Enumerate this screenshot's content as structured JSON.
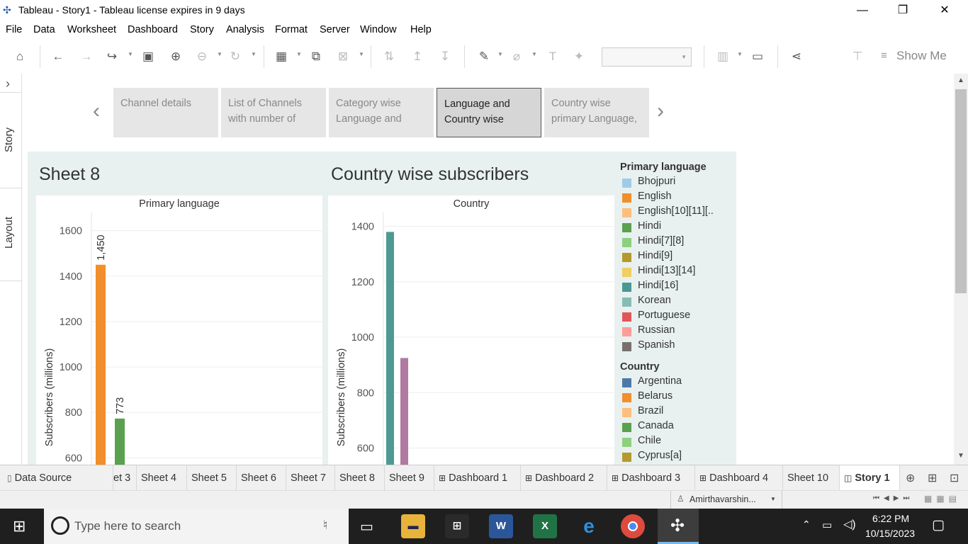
{
  "window": {
    "title": "Tableau - Story1 - Tableau license expires in 9 days",
    "minimize": "—",
    "restore": "❐",
    "close": "✕"
  },
  "menu": [
    "File",
    "Data",
    "Worksheet",
    "Dashboard",
    "Story",
    "Analysis",
    "Format",
    "Server",
    "Window",
    "Help"
  ],
  "toolbar": {
    "show_me": "Show Me"
  },
  "left_rail": {
    "story_label": "Story",
    "layout_label": "Layout",
    "expand": "›"
  },
  "story_points": [
    {
      "label": "Channel details"
    },
    {
      "label": "List of Channels with number of"
    },
    {
      "label": "Category wise Language and"
    },
    {
      "label": "Language and Country wise"
    },
    {
      "label": "Country wise primary Language,"
    }
  ],
  "story_nav": {
    "prev": "‹",
    "next": "›"
  },
  "dashboard": {
    "left_title": "Sheet 8",
    "right_title": "Country wise subscribers",
    "left_chart": {
      "header": "Primary language",
      "y_label": "Subscribers (millions)",
      "ticks": [
        "1600",
        "1400",
        "1200",
        "1000",
        "800",
        "600"
      ]
    },
    "right_chart": {
      "header": "Country",
      "y_label": "Subscribers (millions)",
      "ticks": [
        "1400",
        "1200",
        "1000",
        "800",
        "600"
      ]
    }
  },
  "chart_data": [
    {
      "type": "bar",
      "title": "Sheet 8",
      "xlabel": "Primary language",
      "ylabel": "Subscribers (millions)",
      "ylim": [
        570,
        1680
      ],
      "categories": [
        "English",
        "Hindi"
      ],
      "values": [
        1450,
        773
      ],
      "value_labels": [
        "1,450",
        "773"
      ],
      "colors": [
        "#f28e2b",
        "#59a14f"
      ]
    },
    {
      "type": "bar",
      "title": "Country wise subscribers",
      "xlabel": "Country",
      "ylabel": "Subscribers (millions)",
      "ylim": [
        540,
        1450
      ],
      "categories": [
        "bar1",
        "bar2"
      ],
      "values": [
        1380,
        925
      ],
      "colors": [
        "#4e9a93",
        "#b07aa1"
      ]
    }
  ],
  "legend": {
    "primary_title": "Primary language",
    "primary_items": [
      {
        "label": "Bhojpuri",
        "color": "#a0cbe8"
      },
      {
        "label": "English",
        "color": "#f28e2b"
      },
      {
        "label": "English[10][11][..",
        "color": "#ffbe7d"
      },
      {
        "label": "Hindi",
        "color": "#59a14f"
      },
      {
        "label": "Hindi[7][8]",
        "color": "#8cd17d"
      },
      {
        "label": "Hindi[9]",
        "color": "#b6992d"
      },
      {
        "label": "Hindi[13][14]",
        "color": "#f1ce63"
      },
      {
        "label": "Hindi[16]",
        "color": "#499894"
      },
      {
        "label": "Korean",
        "color": "#86bcb6"
      },
      {
        "label": "Portuguese",
        "color": "#e15759"
      },
      {
        "label": "Russian",
        "color": "#ff9d9a"
      },
      {
        "label": "Spanish",
        "color": "#79706e"
      }
    ],
    "country_title": "Country",
    "country_items": [
      {
        "label": "Argentina",
        "color": "#4e79a7"
      },
      {
        "label": "Belarus",
        "color": "#f28e2b"
      },
      {
        "label": "Brazil",
        "color": "#ffbe7d"
      },
      {
        "label": "Canada",
        "color": "#59a14f"
      },
      {
        "label": "Chile",
        "color": "#8cd17d"
      },
      {
        "label": "Cyprus[a]",
        "color": "#b6992d"
      }
    ]
  },
  "tabs": [
    {
      "label": "Data Source"
    },
    {
      "label": "et 3"
    },
    {
      "label": "Sheet 4"
    },
    {
      "label": "Sheet 5"
    },
    {
      "label": "Sheet 6"
    },
    {
      "label": "Sheet 7"
    },
    {
      "label": "Sheet 8"
    },
    {
      "label": "Sheet 9"
    },
    {
      "label": "Dashboard 1"
    },
    {
      "label": "Dashboard 2"
    },
    {
      "label": "Dashboard 3"
    },
    {
      "label": "Dashboard 4"
    },
    {
      "label": "Sheet 10"
    },
    {
      "label": "Story 1"
    }
  ],
  "status": {
    "user": "Amirthavarshin..."
  },
  "taskbar": {
    "search_placeholder": "Type here to search",
    "time": "6:22 PM",
    "date": "10/15/2023"
  }
}
